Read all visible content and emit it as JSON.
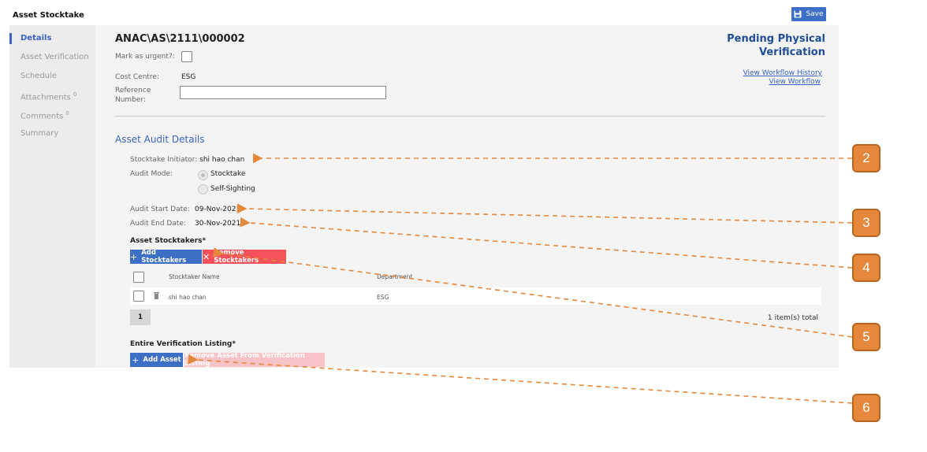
{
  "app": {
    "title": "Asset Stocktake",
    "save_label": "Save"
  },
  "sidebar": {
    "items": [
      {
        "label": "Details",
        "count": ""
      },
      {
        "label": "Asset Verification",
        "count": ""
      },
      {
        "label": "Schedule",
        "count": ""
      },
      {
        "label": "Attachments",
        "count": "0"
      },
      {
        "label": "Comments",
        "count": "0"
      },
      {
        "label": "Summary",
        "count": ""
      }
    ]
  },
  "header": {
    "doc_number": "ANAC\\AS\\2111\\000002",
    "urgent_label": "Mark as urgent?:",
    "cost_centre_label": "Cost Centre:",
    "cost_centre_value": "ESG",
    "reference_label_1": "Reference",
    "reference_label_2": "Number:",
    "reference_value": "",
    "status_line1": "Pending Physical",
    "status_line2": "Verification",
    "link_history": "View Workflow History",
    "link_workflow": "View Workflow"
  },
  "audit": {
    "section_title": "Asset Audit Details",
    "initiator_label": "Stocktake Initiator:",
    "initiator_value": "shi hao chan",
    "mode_label": "Audit Mode:",
    "mode_options": [
      "Stocktake",
      "Self-Sighting"
    ],
    "mode_selected": "Stocktake",
    "start_label": "Audit Start Date:",
    "start_value": "09-Nov-2021",
    "end_label": "Audit End Date:",
    "end_value": "30-Nov-2021"
  },
  "stocktakers": {
    "title": "Asset Stocktakers*",
    "add_label": "Add Stocktakers",
    "remove_label": "Remove Stocktakers",
    "columns": [
      "Stocktaker Name",
      "Department"
    ],
    "rows": [
      {
        "name": "shi hao chan",
        "department": "ESG"
      }
    ],
    "page": "1",
    "total": "1 item(s) total"
  },
  "verification": {
    "title": "Entire Verification Listing*",
    "add_label": "Add Asset",
    "remove_label": "Remove Asset From Verification Listing"
  },
  "callouts": [
    "2",
    "3",
    "4",
    "5",
    "6"
  ],
  "colors": {
    "accent": "#3d6fc6",
    "danger": "#f4515a",
    "callout": "#e5883b",
    "status": "#1f4e96"
  }
}
